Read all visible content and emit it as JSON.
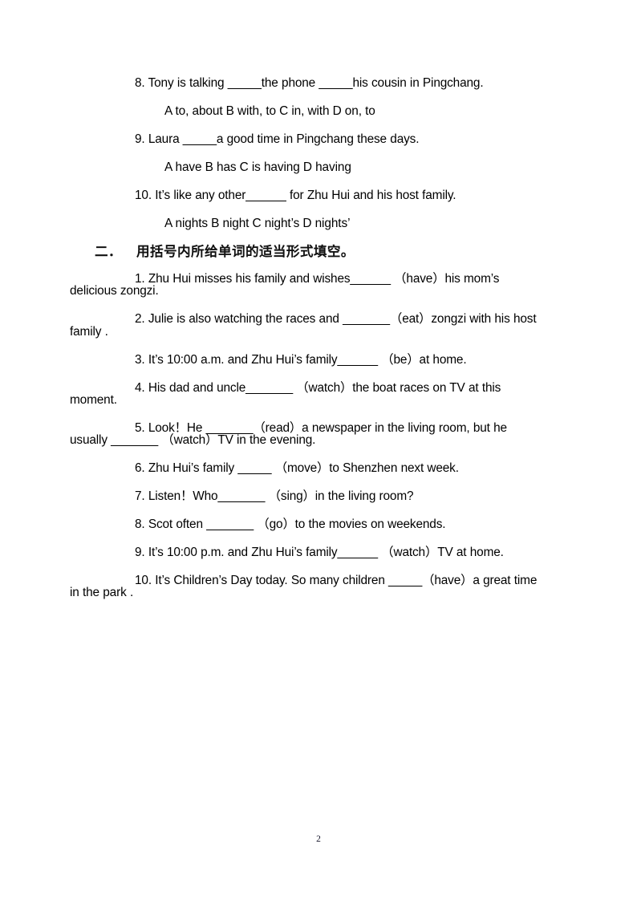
{
  "document": {
    "page_number": "2",
    "background_color": "#ffffff",
    "text_color": "#000000"
  },
  "section_one_tail": {
    "questions": [
      {
        "id": "q8",
        "stem": "8. Tony is talking _____the phone _____his cousin in Pingchang.",
        "options": "A to, about B with, to C in, with    D on, to"
      },
      {
        "id": "q9",
        "stem": "9. Laura _____a good time in Pingchang these days.",
        "options": "A have    B has    C is having    D having"
      },
      {
        "id": "q10",
        "stem": "10. It’s like any other______ for Zhu Hui and his host family.",
        "options": "A nights     B night     C night’s     D nights’"
      }
    ]
  },
  "section_two": {
    "heading_number": "二．",
    "heading_text": "用括号内所给单词的适当形式填空。",
    "questions": [
      {
        "id": "s2q1",
        "text": "1. Zhu Hui misses his family and wishes______ （have）his mom’s delicious zongzi."
      },
      {
        "id": "s2q2",
        "text": "2. Julie is also watching the races and _______（eat）zongzi with his host family ."
      },
      {
        "id": "s2q3",
        "text": "3. It’s 10:00 a.m. and Zhu Hui’s family______ （be）at home."
      },
      {
        "id": "s2q4",
        "text": "4. His dad and uncle_______ （watch）the boat races on TV at this moment."
      },
      {
        "id": "s2q5",
        "text": "5. Look！He _______（read）a newspaper in the living room, but he usually _______ （watch）TV in the evening."
      },
      {
        "id": "s2q6",
        "text": "6. Zhu Hui’s family _____ （move）to Shenzhen next week."
      },
      {
        "id": "s2q7",
        "text": "7. Listen！Who_______ （sing）in the living room?"
      },
      {
        "id": "s2q8",
        "text": "8. Scot often _______ （go）to the movies on weekends."
      },
      {
        "id": "s2q9",
        "text": "9. It’s 10:00 p.m. and Zhu Hui’s family______ （watch）TV at home."
      },
      {
        "id": "s2q10",
        "text": "10. It’s Children’s Day today. So many children _____（have）a great time in the park ."
      }
    ]
  }
}
